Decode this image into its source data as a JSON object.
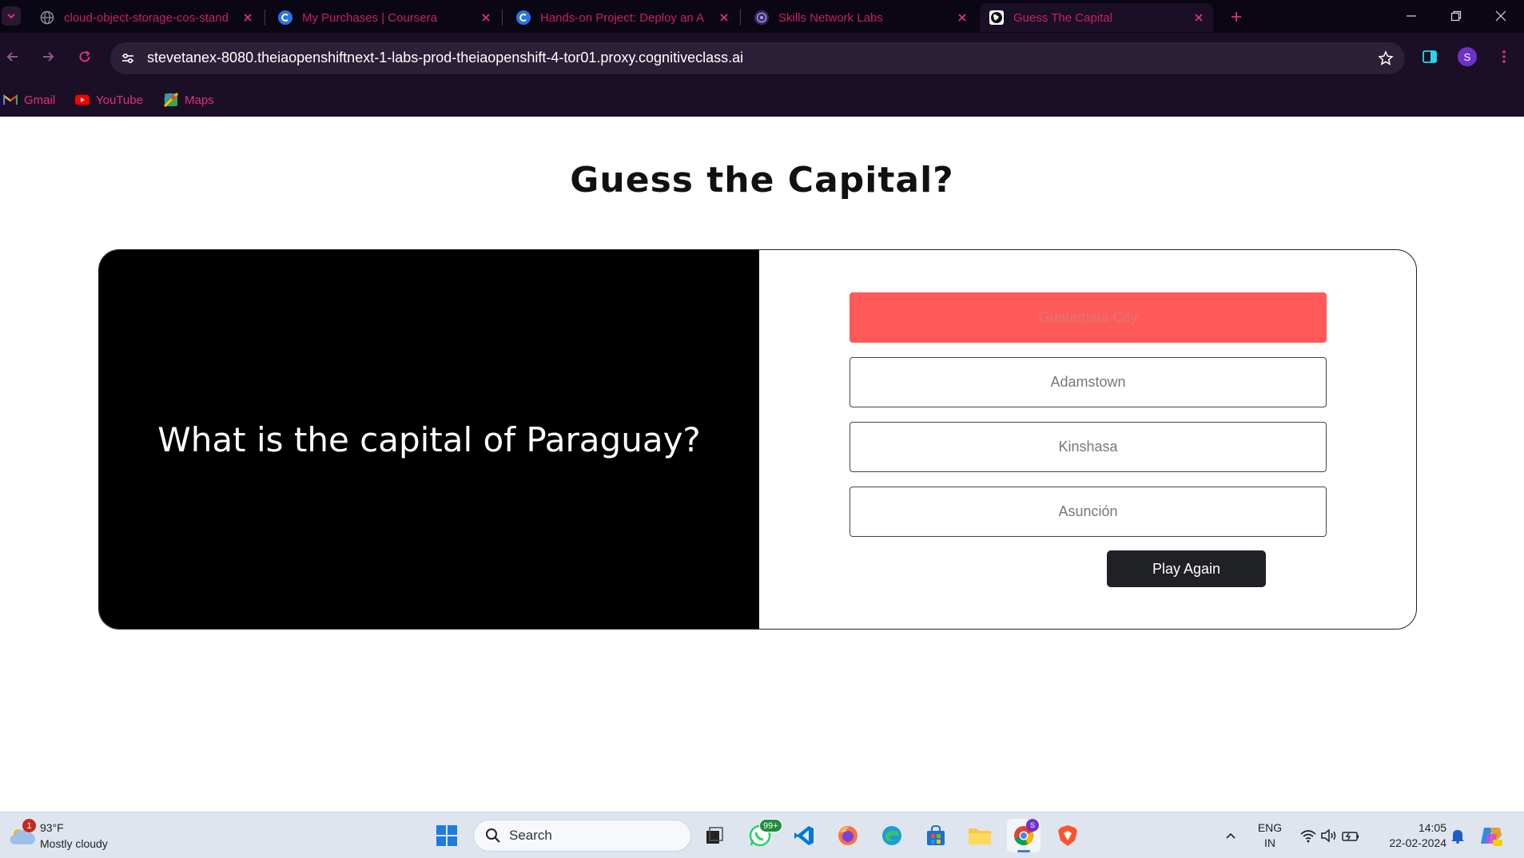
{
  "browser": {
    "tabs": [
      {
        "title": "cloud-object-storage-cos-stand",
        "favicon": "globe-icon",
        "active": false
      },
      {
        "title": "My Purchases | Coursera",
        "favicon": "coursera-icon",
        "active": false
      },
      {
        "title": "Hands-on Project: Deploy an A",
        "favicon": "coursera-icon",
        "active": false
      },
      {
        "title": "Skills Network Labs",
        "favicon": "skills-network-icon",
        "active": false
      },
      {
        "title": "Guess The Capital",
        "favicon": "globe-bw-icon",
        "active": true
      }
    ],
    "url": "stevetanex-8080.theiaopenshiftnext-1-labs-prod-theiaopenshift-4-tor01.proxy.cognitiveclass.ai",
    "profile_initial": "S",
    "bookmarks": [
      {
        "label": "Gmail",
        "icon": "gmail-icon"
      },
      {
        "label": "YouTube",
        "icon": "youtube-icon"
      },
      {
        "label": "Maps",
        "icon": "maps-icon"
      }
    ],
    "colors": {
      "chrome_bg": "#1a0f26",
      "tab_text": "#c8215f",
      "bookmark_text": "#e0307e"
    }
  },
  "page": {
    "title": "Guess the Capital?",
    "question": "What is the capital of Paraguay?",
    "answers": [
      {
        "label": "Guatemala City",
        "state": "wrong"
      },
      {
        "label": "Adamstown",
        "state": "default"
      },
      {
        "label": "Kinshasa",
        "state": "default"
      },
      {
        "label": "Asunción",
        "state": "default"
      }
    ],
    "play_again_label": "Play Again",
    "colors": {
      "wrong_answer": "#ff5a5a",
      "question_bg": "#000000",
      "button_dark": "#1f2124"
    }
  },
  "taskbar": {
    "weather": {
      "temp": "93°F",
      "condition": "Mostly cloudy",
      "badge": "1"
    },
    "search_label": "Search",
    "whatsapp_badge": "99+",
    "chrome_profile_badge": "S",
    "language": {
      "line1": "ENG",
      "line2": "IN"
    },
    "clock": {
      "time": "14:05",
      "date": "22-02-2024"
    }
  }
}
